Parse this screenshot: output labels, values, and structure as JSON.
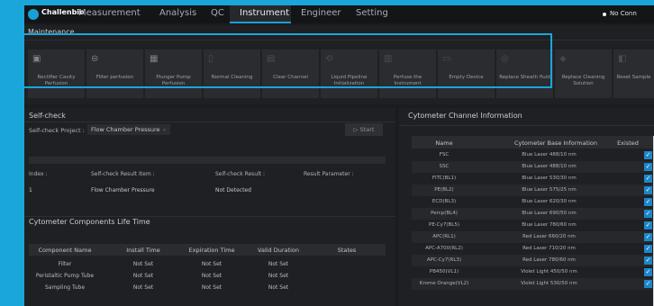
{
  "app": {
    "logo_text": "Challenbio"
  },
  "menu": [
    {
      "label": "Measurement",
      "active": false
    },
    {
      "label": "Analysis",
      "active": false
    },
    {
      "label": "QC",
      "active": false
    },
    {
      "label": "Instrument",
      "active": true
    },
    {
      "label": "Engineer",
      "active": false
    },
    {
      "label": "Setting",
      "active": false
    }
  ],
  "connection": {
    "status": "No Conn"
  },
  "maintenance": {
    "title": "Maintenance",
    "tiles": [
      {
        "label": "Rectifier Cavity Perfusion",
        "icon": "cavity-icon"
      },
      {
        "label": "Filter perfusion",
        "icon": "filter-icon"
      },
      {
        "label": "Plunger Pump Perfusion",
        "icon": "pump-icon"
      },
      {
        "label": "Normal Cleaning",
        "icon": "cleaning-icon"
      },
      {
        "label": "Clear Channel",
        "icon": "channel-icon"
      },
      {
        "label": "Liquid Pipeline Initialization",
        "icon": "pipeline-icon"
      },
      {
        "label": "Perfuse the Instrument",
        "icon": "instrument-icon"
      },
      {
        "label": "Empty Device",
        "icon": "empty-icon"
      },
      {
        "label": "Replace Sheath fluid",
        "icon": "sheath-icon"
      },
      {
        "label": "Replace Cleaning Solution",
        "icon": "solution-icon"
      },
      {
        "label": "Reset Sample",
        "icon": "reset-icon"
      }
    ]
  },
  "selfcheck": {
    "title": "Self-check",
    "project_label": "Self-check Project :",
    "project_value": "Flow Chamber Pressure",
    "start_label": "Start",
    "headers": [
      "Index :",
      "Self-check Result Item :",
      "Self-check Result :",
      "Result Parameter :"
    ],
    "row": [
      "1",
      "Flow Chamber Pressure",
      "Not Detected",
      ""
    ]
  },
  "lifetime": {
    "title": "Cytometer Components Life Time",
    "headers": [
      "Component Name",
      "Install Time",
      "Expiration Time",
      "Valid Duration",
      "States"
    ],
    "rows": [
      [
        "Filter",
        "Not Set",
        "Not Set",
        "Not Set",
        ""
      ],
      [
        "Peristaltic Pump Tube",
        "Not Set",
        "Not Set",
        "Not Set",
        ""
      ],
      [
        "Sampling Tube",
        "Not Set",
        "Not Set",
        "Not Set",
        ""
      ]
    ]
  },
  "channel": {
    "title": "Cytometer Channel Information",
    "headers": [
      "Name",
      "Cytometer Base Information",
      "Existed"
    ],
    "rows": [
      [
        "FSC",
        "Blue Laser 488/10 nm"
      ],
      [
        "SSC",
        "Blue Laser 488/10 nm"
      ],
      [
        "FITC(BL1)",
        "Blue Laser 530/30 nm"
      ],
      [
        "PE(BL2)",
        "Blue Laser 575/25 nm"
      ],
      [
        "ECD(BL3)",
        "Blue Laser 620/30 nm"
      ],
      [
        "Percp(BL4)",
        "Blue Laser 690/50 nm"
      ],
      [
        "PE-Cy7(BL5)",
        "Blue Laser 780/60 nm"
      ],
      [
        "APC(RL1)",
        "Red Laser 660/20 nm"
      ],
      [
        "APC-A700(RL2)",
        "Red Laser 710/20 nm"
      ],
      [
        "APC-Cy7(RL3)",
        "Red Laser 780/60 nm"
      ],
      [
        "PB450(VL1)",
        "Violet Light 450/50 nm"
      ],
      [
        "Krome Orange(VL2)",
        "Violet Light 530/50 nm"
      ]
    ]
  },
  "colors": {
    "accent": "#1aa6d9",
    "background": "#1b1c1f",
    "panel": "#1f2023",
    "check": "#1d86c8"
  }
}
